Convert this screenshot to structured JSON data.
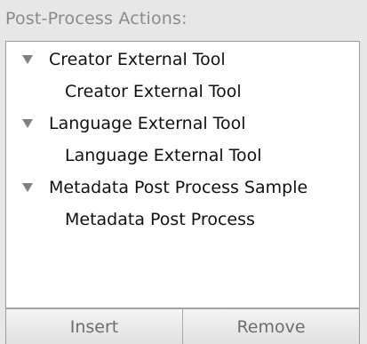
{
  "panel": {
    "title": "Post-Process Actions:"
  },
  "tree": {
    "items": [
      {
        "label": "Creator External Tool",
        "type": "group",
        "icon": "disclosure-triangle-down-icon"
      },
      {
        "label": "Creator External Tool",
        "type": "child"
      },
      {
        "label": "Language External Tool",
        "type": "group",
        "icon": "disclosure-triangle-down-icon"
      },
      {
        "label": "Language External Tool",
        "type": "child"
      },
      {
        "label": "Metadata Post Process Sample",
        "type": "group",
        "icon": "disclosure-triangle-down-icon"
      },
      {
        "label": "Metadata Post Process",
        "type": "child"
      }
    ]
  },
  "buttons": {
    "insert_label": "Insert",
    "remove_label": "Remove"
  },
  "colors": {
    "background": "#e7e7e7",
    "list_background": "#ffffff",
    "header_text": "#8a8a8a",
    "item_text": "#111111",
    "button_text": "#6e6e6e",
    "triangle": "#7f7f7f"
  }
}
